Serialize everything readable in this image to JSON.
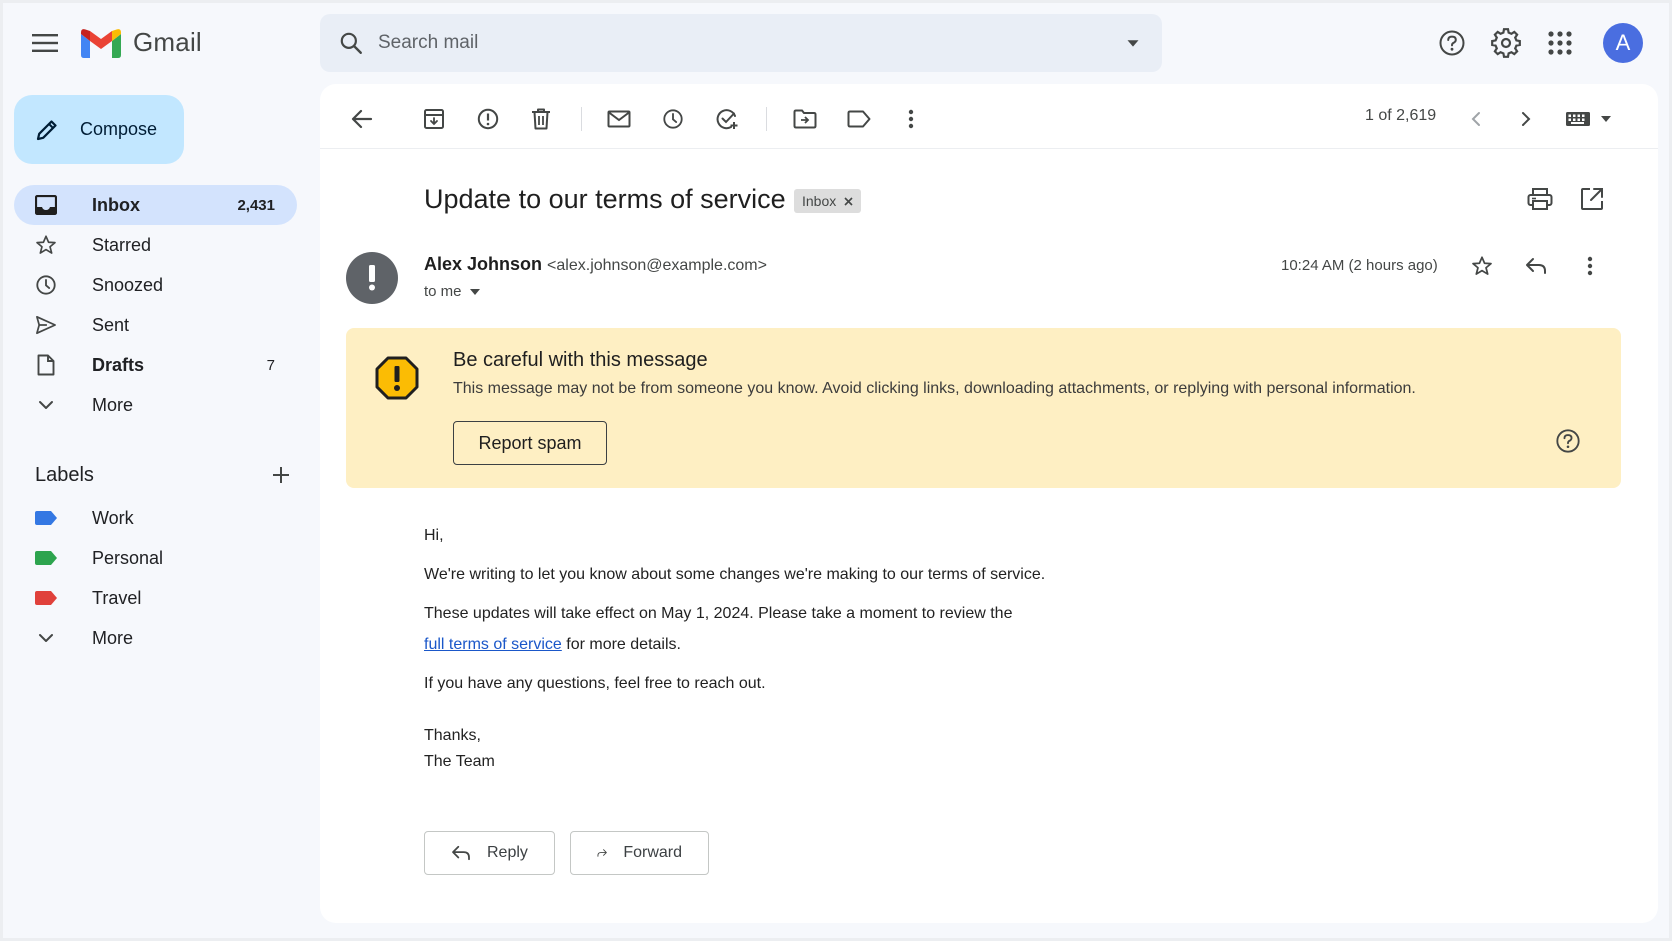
{
  "app": {
    "name": "Gmail"
  },
  "search": {
    "placeholder": "Search mail"
  },
  "user": {
    "initial": "A"
  },
  "compose": {
    "label": "Compose"
  },
  "nav": [
    {
      "label": "Inbox",
      "count": "2,431",
      "icon": "inbox-icon"
    },
    {
      "label": "Starred",
      "count": "",
      "icon": "star-icon"
    },
    {
      "label": "Snoozed",
      "count": "",
      "icon": "clock-icon"
    },
    {
      "label": "Sent",
      "count": "",
      "icon": "send-icon"
    },
    {
      "label": "Drafts",
      "count": "7",
      "icon": "draft-icon"
    },
    {
      "label": "More",
      "count": "",
      "icon": "chevron-down-icon"
    }
  ],
  "labels": {
    "title": "Labels",
    "items": [
      {
        "label": "Work",
        "color": "#3478e3"
      },
      {
        "label": "Personal",
        "color": "#2da44e"
      },
      {
        "label": "Travel",
        "color": "#e0413b"
      }
    ],
    "more": "More"
  },
  "toolbar": {
    "pager": "1 of 2,619"
  },
  "email": {
    "subject": "Update to our terms of service",
    "chip": "Inbox",
    "sender_name": "Alex Johnson",
    "sender_email": "<alex.johnson@example.com>",
    "to": "to me",
    "time": "10:24 AM (2 hours ago)",
    "body": {
      "greeting": "Hi,",
      "p1": "We're writing to let you know about some changes we're making to our terms of service.",
      "p2": "These updates will take effect on May 1, 2024. Please take a moment to review the",
      "link": "full terms of service",
      "p2_end": " for more details.",
      "p3": "If you have any questions, feel free to reach out.",
      "thanks": "Thanks,",
      "sign": "The Team"
    }
  },
  "warning": {
    "title": "Be careful with this message",
    "text": "This message may not be from someone you know. Avoid clicking links, downloading attachments, or replying with personal information.",
    "button": "Report spam"
  },
  "actions": {
    "reply": "Reply",
    "forward": "Forward"
  }
}
